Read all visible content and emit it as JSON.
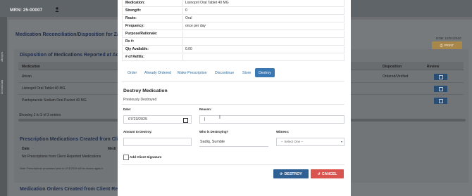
{
  "header": {
    "mrn": "MRN: 25-00007",
    "icon": "person-icon"
  },
  "sidebar": {
    "items": [
      "Allergies",
      "Clinical Data"
    ]
  },
  "background": {
    "title": "Medication Reconciliation/Disposition for Zacha",
    "dob": "DOB: 12/01/2010",
    "print_label": "PRINT",
    "section1_title": "Disposition of Medications Reported at Admis",
    "columns": {
      "medication": "Medication",
      "disposition": "Disposition",
      "review": "Review"
    },
    "rows": [
      {
        "medication": "Ativan",
        "disposition": "Ordered/Verified"
      },
      {
        "medication": "Lisinopril Oral Tablet 40 MG",
        "disposition": ""
      },
      {
        "medication": "Pantoprazole Sodium Oral Packet 40 MG",
        "disposition": ""
      }
    ],
    "showing": "Showing 1 to 3 of 3 entries",
    "section2_title": "Prescription Medications Created from Client R",
    "section2_date_col": "Date",
    "section2_med_col": "Medi",
    "section2_empty": "No Prescriptions from Client Reported Medications",
    "note": "Note: Prescriptions processed prior to 2/11/2025 will be shown again b",
    "section3_title": "Medication Orders Created from Client Reported Medications"
  },
  "modal": {
    "details": [
      {
        "key": "Medication:",
        "value": "Lisinopril Oral Tablet 40 MG"
      },
      {
        "key": "Strength:",
        "value": "0"
      },
      {
        "key": "Route:",
        "value": "Oral"
      },
      {
        "key": "Frequency:",
        "value": "once per day"
      },
      {
        "key": "Purpose/Rationale:",
        "value": ""
      },
      {
        "key": "Rx #:",
        "value": ""
      },
      {
        "key": "Qty Available:",
        "value": "0.00"
      },
      {
        "key": "# of Refills:",
        "value": ""
      }
    ],
    "tabs": [
      "Order",
      "Already Ordered",
      "Make Prescription",
      "Discontinue",
      "Store",
      "Destroy"
    ],
    "active_tab": "Destroy",
    "section_title": "Destroy Medication",
    "previously": "Previously Destroyed",
    "date_label": "Date:",
    "date_value": "07/23/2025",
    "reason_label": "Reason:",
    "reason_value": "|",
    "amount_label": "Amount to Destroy:",
    "amount_value": "",
    "who_label": "Who is Destroying?",
    "who_value": "Sadiq, Sumble",
    "witness_label": "Witness:",
    "witness_value": "-- Select One --",
    "signature_label": "Add Client Signature",
    "destroy_btn": "DESTROY",
    "cancel_btn": "CANCEL",
    "colors": {
      "primary": "#2f5f93",
      "cancel": "#d9534f",
      "tab_active": "#3a78b4"
    }
  }
}
